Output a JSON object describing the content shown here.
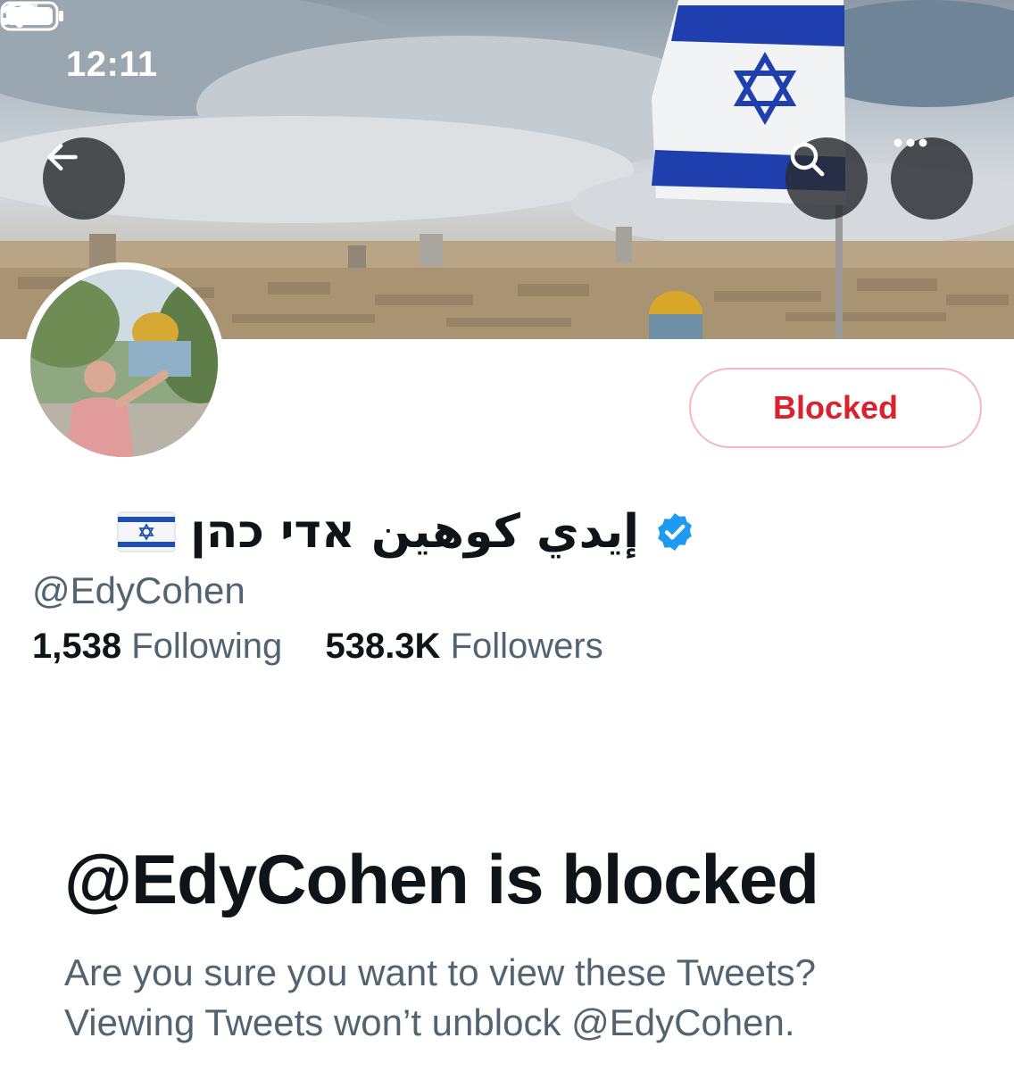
{
  "status_bar": {
    "time": "12:11",
    "location_icon": "location-arrow-icon",
    "signal_icon": "cellular-signal-icon",
    "wifi_icon": "wifi-icon",
    "battery_icon": "battery-icon"
  },
  "header": {
    "back_icon": "arrow-left-icon",
    "search_icon": "search-icon",
    "more_icon": "more-horizontal-icon"
  },
  "profile": {
    "display_name": "إيدي كوهين אדי כהן",
    "verified_icon": "verified-badge-icon",
    "flag_icon": "israel-flag-icon",
    "handle": "@EdyCohen",
    "following_count": "1,538",
    "following_label": "Following",
    "followers_count": "538.3K",
    "followers_label": "Followers",
    "blocked_button": "Blocked"
  },
  "blocked_notice": {
    "title": "@EdyCohen is blocked",
    "line1": "Are you sure you want to view these Tweets?",
    "line2": "Viewing Tweets won’t unblock @EdyCohen."
  },
  "colors": {
    "accent_blue": "#1d9bf0",
    "blocked_red": "#d8232f",
    "secondary_text": "#536471",
    "primary_text": "#0f1419"
  }
}
